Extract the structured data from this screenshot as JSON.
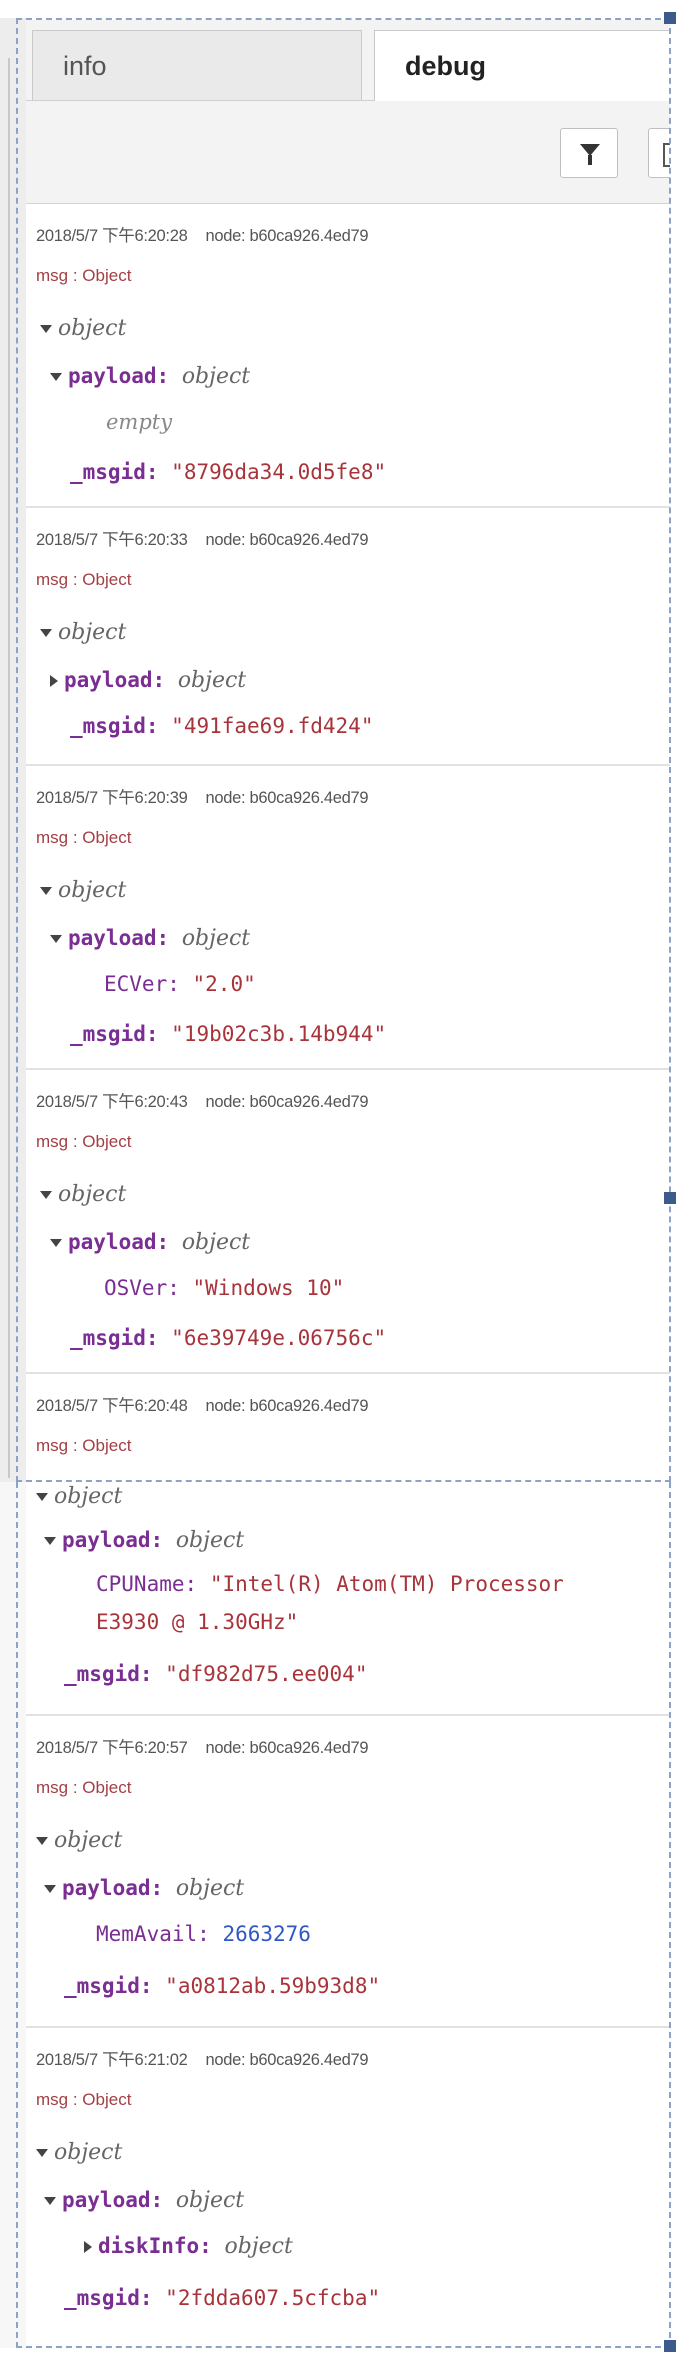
{
  "tabs": {
    "info": "info",
    "debug": "debug"
  },
  "icons": {
    "filter": "funnel-icon",
    "clear": "trash-icon",
    "expanded": "triangle-down-icon",
    "collapsed": "triangle-right-icon"
  },
  "messages": [
    {
      "timestamp": "2018/5/7 下午6:20:28",
      "node": "node: b60ca926.4ed79",
      "topic": "msg : Object",
      "root": "object",
      "payload_key": "payload:",
      "payload_type": "object",
      "payload_line": "empty",
      "msgid_key": "_msgid:",
      "msgid": "\"8796da34.0d5fe8\""
    },
    {
      "timestamp": "2018/5/7 下午6:20:33",
      "node": "node: b60ca926.4ed79",
      "topic": "msg : Object",
      "root": "object",
      "payload_key": "payload:",
      "payload_type": "object",
      "msgid_key": "_msgid:",
      "msgid": "\"491fae69.fd424\""
    },
    {
      "timestamp": "2018/5/7 下午6:20:39",
      "node": "node: b60ca926.4ed79",
      "topic": "msg : Object",
      "root": "object",
      "payload_key": "payload:",
      "payload_type": "object",
      "field_key": "ECVer:",
      "field_value": "\"2.0\"",
      "msgid_key": "_msgid:",
      "msgid": "\"19b02c3b.14b944\""
    },
    {
      "timestamp": "2018/5/7 下午6:20:43",
      "node": "node: b60ca926.4ed79",
      "topic": "msg : Object",
      "root": "object",
      "payload_key": "payload:",
      "payload_type": "object",
      "field_key": "OSVer:",
      "field_value": "\"Windows 10\"",
      "msgid_key": "_msgid:",
      "msgid": "\"6e39749e.06756c\""
    },
    {
      "timestamp": "2018/5/7 下午6:20:48",
      "node": "node: b60ca926.4ed79",
      "topic": "msg : Object",
      "root": "object",
      "payload_key": "payload:",
      "payload_type": "object",
      "field_key": "CPUName:",
      "field_value": "\"Intel(R) Atom(TM) Processor",
      "field_value_cont": "E3930 @ 1.30GHz\"",
      "msgid_key": "_msgid:",
      "msgid": "\"df982d75.ee004\""
    },
    {
      "timestamp": "2018/5/7 下午6:20:57",
      "node": "node: b60ca926.4ed79",
      "topic": "msg : Object",
      "root": "object",
      "payload_key": "payload:",
      "payload_type": "object",
      "field_key": "MemAvail:",
      "field_value": "2663276",
      "msgid_key": "_msgid:",
      "msgid": "\"a0812ab.59b93d8\""
    },
    {
      "timestamp": "2018/5/7 下午6:21:02",
      "node": "node: b60ca926.4ed79",
      "topic": "msg : Object",
      "root": "object",
      "payload_key": "payload:",
      "payload_type": "object",
      "field_key": "diskInfo:",
      "field_value": "object",
      "msgid_key": "_msgid:",
      "msgid": "\"2fdda607.5cfcba\""
    }
  ]
}
